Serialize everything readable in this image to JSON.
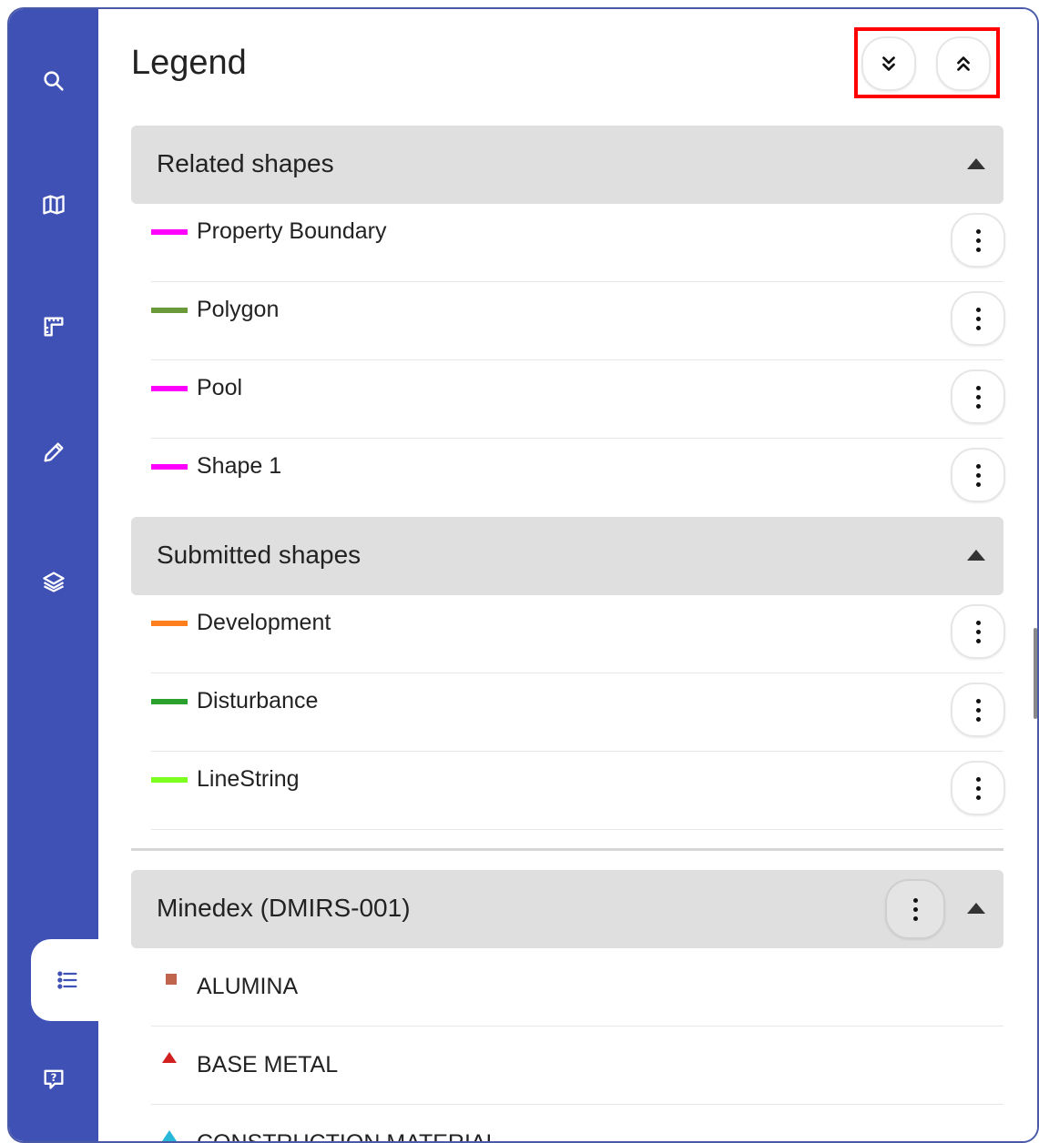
{
  "legend": {
    "title": "Legend",
    "expand_all_icon": "double-chevron-down-icon",
    "collapse_all_icon": "double-chevron-up-icon"
  },
  "sidebar": {
    "items": [
      {
        "name": "search",
        "icon": "search-icon"
      },
      {
        "name": "map",
        "icon": "map-icon"
      },
      {
        "name": "measure",
        "icon": "ruler-icon"
      },
      {
        "name": "draw",
        "icon": "pencil-icon"
      },
      {
        "name": "layers",
        "icon": "layers-icon"
      },
      {
        "name": "legend",
        "icon": "list-icon",
        "active": true
      },
      {
        "name": "help",
        "icon": "help-icon"
      }
    ]
  },
  "sections": {
    "related": {
      "title": "Related shapes",
      "items": [
        {
          "label": "Property Boundary",
          "color": "#ff00ff"
        },
        {
          "label": "Polygon",
          "color": "#6b9a3a"
        },
        {
          "label": "Pool",
          "color": "#ff00ff"
        },
        {
          "label": "Shape 1",
          "color": "#ff00ff"
        }
      ]
    },
    "submitted": {
      "title": "Submitted shapes",
      "items": [
        {
          "label": "Development",
          "color": "#ff7f1e"
        },
        {
          "label": "Disturbance",
          "color": "#2ca02c"
        },
        {
          "label": "LineString",
          "color": "#7cff1e"
        }
      ]
    },
    "minedex": {
      "title": "Minedex (DMIRS-001)",
      "items": [
        {
          "label": "ALUMINA",
          "symbol": "square",
          "color": "#c0644e"
        },
        {
          "label": "BASE METAL",
          "symbol": "triangle",
          "color": "#d22020"
        },
        {
          "label": "CONSTRUCTION MATERIAL",
          "symbol": "triangle",
          "color": "#27b8d8"
        }
      ]
    }
  },
  "colors": {
    "sidebar": "#3f51b5",
    "highlight": "#ff0000",
    "section_header": "#dfdfdf"
  }
}
